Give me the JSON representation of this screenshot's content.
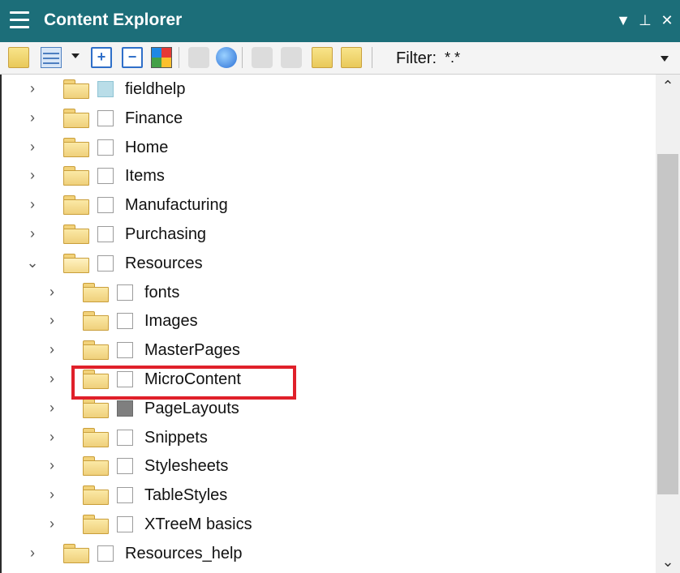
{
  "window": {
    "title": "Content Explorer",
    "menu_icon": "hamburger-menu-icon",
    "dropdown_glyph": "▼",
    "pin_glyph": "⊥",
    "close_glyph": "✕"
  },
  "toolbar": {
    "filter_label": "Filter:",
    "filter_value": "*.*"
  },
  "tree": {
    "collapsed_glyph": "›",
    "expanded_glyph": "⌄",
    "items": [
      {
        "label": "fieldhelp",
        "level": 0,
        "expanded": false,
        "checkbox": "light-blue"
      },
      {
        "label": "Finance",
        "level": 0,
        "expanded": false,
        "checkbox": "empty"
      },
      {
        "label": "Home",
        "level": 0,
        "expanded": false,
        "checkbox": "empty"
      },
      {
        "label": "Items",
        "level": 0,
        "expanded": false,
        "checkbox": "empty"
      },
      {
        "label": "Manufacturing",
        "level": 0,
        "expanded": false,
        "checkbox": "empty"
      },
      {
        "label": "Purchasing",
        "level": 0,
        "expanded": false,
        "checkbox": "empty"
      },
      {
        "label": "Resources",
        "level": 0,
        "expanded": true,
        "checkbox": "empty"
      },
      {
        "label": "fonts",
        "level": 1,
        "expanded": false,
        "checkbox": "empty"
      },
      {
        "label": "Images",
        "level": 1,
        "expanded": false,
        "checkbox": "empty"
      },
      {
        "label": "MasterPages",
        "level": 1,
        "expanded": false,
        "checkbox": "empty"
      },
      {
        "label": "MicroContent",
        "level": 1,
        "expanded": false,
        "checkbox": "empty",
        "highlighted": true
      },
      {
        "label": "PageLayouts",
        "level": 1,
        "expanded": false,
        "checkbox": "gray"
      },
      {
        "label": "Snippets",
        "level": 1,
        "expanded": false,
        "checkbox": "empty"
      },
      {
        "label": "Stylesheets",
        "level": 1,
        "expanded": false,
        "checkbox": "empty"
      },
      {
        "label": "TableStyles",
        "level": 1,
        "expanded": false,
        "checkbox": "empty"
      },
      {
        "label": "XTreeM basics",
        "level": 1,
        "expanded": false,
        "checkbox": "empty"
      },
      {
        "label": "Resources_help",
        "level": 0,
        "expanded": false,
        "checkbox": "empty"
      }
    ]
  },
  "scrollbar": {
    "up_glyph": "⌃",
    "down_glyph": "⌄",
    "position_fraction": 0.5
  },
  "colors": {
    "titlebar": "#1c6e79",
    "highlight": "#e0202a",
    "checkbox_light_blue": "#b9dde8",
    "checkbox_gray": "#7f7f7f"
  }
}
